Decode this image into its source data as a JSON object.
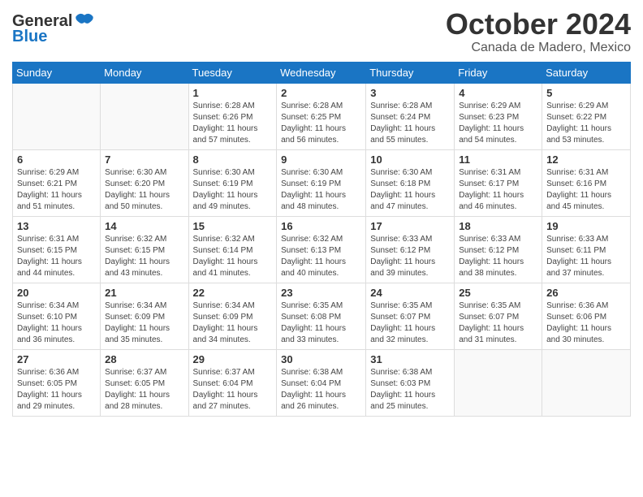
{
  "header": {
    "logo_line1": "General",
    "logo_line2": "Blue",
    "month": "October 2024",
    "location": "Canada de Madero, Mexico"
  },
  "weekdays": [
    "Sunday",
    "Monday",
    "Tuesday",
    "Wednesday",
    "Thursday",
    "Friday",
    "Saturday"
  ],
  "weeks": [
    [
      {
        "day": "",
        "info": ""
      },
      {
        "day": "",
        "info": ""
      },
      {
        "day": "1",
        "info": "Sunrise: 6:28 AM\nSunset: 6:26 PM\nDaylight: 11 hours and 57 minutes."
      },
      {
        "day": "2",
        "info": "Sunrise: 6:28 AM\nSunset: 6:25 PM\nDaylight: 11 hours and 56 minutes."
      },
      {
        "day": "3",
        "info": "Sunrise: 6:28 AM\nSunset: 6:24 PM\nDaylight: 11 hours and 55 minutes."
      },
      {
        "day": "4",
        "info": "Sunrise: 6:29 AM\nSunset: 6:23 PM\nDaylight: 11 hours and 54 minutes."
      },
      {
        "day": "5",
        "info": "Sunrise: 6:29 AM\nSunset: 6:22 PM\nDaylight: 11 hours and 53 minutes."
      }
    ],
    [
      {
        "day": "6",
        "info": "Sunrise: 6:29 AM\nSunset: 6:21 PM\nDaylight: 11 hours and 51 minutes."
      },
      {
        "day": "7",
        "info": "Sunrise: 6:30 AM\nSunset: 6:20 PM\nDaylight: 11 hours and 50 minutes."
      },
      {
        "day": "8",
        "info": "Sunrise: 6:30 AM\nSunset: 6:19 PM\nDaylight: 11 hours and 49 minutes."
      },
      {
        "day": "9",
        "info": "Sunrise: 6:30 AM\nSunset: 6:19 PM\nDaylight: 11 hours and 48 minutes."
      },
      {
        "day": "10",
        "info": "Sunrise: 6:30 AM\nSunset: 6:18 PM\nDaylight: 11 hours and 47 minutes."
      },
      {
        "day": "11",
        "info": "Sunrise: 6:31 AM\nSunset: 6:17 PM\nDaylight: 11 hours and 46 minutes."
      },
      {
        "day": "12",
        "info": "Sunrise: 6:31 AM\nSunset: 6:16 PM\nDaylight: 11 hours and 45 minutes."
      }
    ],
    [
      {
        "day": "13",
        "info": "Sunrise: 6:31 AM\nSunset: 6:15 PM\nDaylight: 11 hours and 44 minutes."
      },
      {
        "day": "14",
        "info": "Sunrise: 6:32 AM\nSunset: 6:15 PM\nDaylight: 11 hours and 43 minutes."
      },
      {
        "day": "15",
        "info": "Sunrise: 6:32 AM\nSunset: 6:14 PM\nDaylight: 11 hours and 41 minutes."
      },
      {
        "day": "16",
        "info": "Sunrise: 6:32 AM\nSunset: 6:13 PM\nDaylight: 11 hours and 40 minutes."
      },
      {
        "day": "17",
        "info": "Sunrise: 6:33 AM\nSunset: 6:12 PM\nDaylight: 11 hours and 39 minutes."
      },
      {
        "day": "18",
        "info": "Sunrise: 6:33 AM\nSunset: 6:12 PM\nDaylight: 11 hours and 38 minutes."
      },
      {
        "day": "19",
        "info": "Sunrise: 6:33 AM\nSunset: 6:11 PM\nDaylight: 11 hours and 37 minutes."
      }
    ],
    [
      {
        "day": "20",
        "info": "Sunrise: 6:34 AM\nSunset: 6:10 PM\nDaylight: 11 hours and 36 minutes."
      },
      {
        "day": "21",
        "info": "Sunrise: 6:34 AM\nSunset: 6:09 PM\nDaylight: 11 hours and 35 minutes."
      },
      {
        "day": "22",
        "info": "Sunrise: 6:34 AM\nSunset: 6:09 PM\nDaylight: 11 hours and 34 minutes."
      },
      {
        "day": "23",
        "info": "Sunrise: 6:35 AM\nSunset: 6:08 PM\nDaylight: 11 hours and 33 minutes."
      },
      {
        "day": "24",
        "info": "Sunrise: 6:35 AM\nSunset: 6:07 PM\nDaylight: 11 hours and 32 minutes."
      },
      {
        "day": "25",
        "info": "Sunrise: 6:35 AM\nSunset: 6:07 PM\nDaylight: 11 hours and 31 minutes."
      },
      {
        "day": "26",
        "info": "Sunrise: 6:36 AM\nSunset: 6:06 PM\nDaylight: 11 hours and 30 minutes."
      }
    ],
    [
      {
        "day": "27",
        "info": "Sunrise: 6:36 AM\nSunset: 6:05 PM\nDaylight: 11 hours and 29 minutes."
      },
      {
        "day": "28",
        "info": "Sunrise: 6:37 AM\nSunset: 6:05 PM\nDaylight: 11 hours and 28 minutes."
      },
      {
        "day": "29",
        "info": "Sunrise: 6:37 AM\nSunset: 6:04 PM\nDaylight: 11 hours and 27 minutes."
      },
      {
        "day": "30",
        "info": "Sunrise: 6:38 AM\nSunset: 6:04 PM\nDaylight: 11 hours and 26 minutes."
      },
      {
        "day": "31",
        "info": "Sunrise: 6:38 AM\nSunset: 6:03 PM\nDaylight: 11 hours and 25 minutes."
      },
      {
        "day": "",
        "info": ""
      },
      {
        "day": "",
        "info": ""
      }
    ]
  ]
}
